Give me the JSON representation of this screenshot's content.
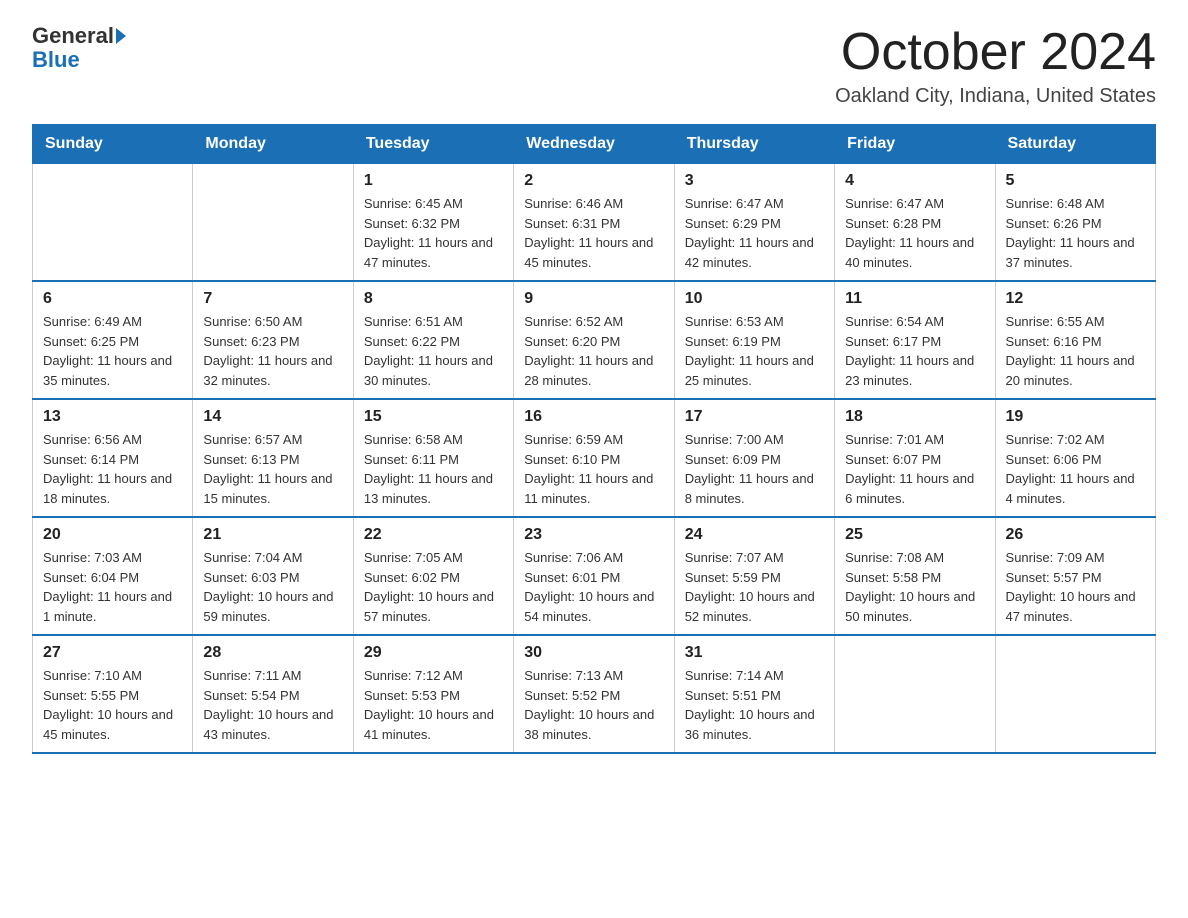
{
  "header": {
    "logo_general": "General",
    "logo_blue": "Blue",
    "month_title": "October 2024",
    "location": "Oakland City, Indiana, United States"
  },
  "days_of_week": [
    "Sunday",
    "Monday",
    "Tuesday",
    "Wednesday",
    "Thursday",
    "Friday",
    "Saturday"
  ],
  "weeks": [
    [
      {
        "day": "",
        "info": ""
      },
      {
        "day": "",
        "info": ""
      },
      {
        "day": "1",
        "info": "Sunrise: 6:45 AM\nSunset: 6:32 PM\nDaylight: 11 hours and 47 minutes."
      },
      {
        "day": "2",
        "info": "Sunrise: 6:46 AM\nSunset: 6:31 PM\nDaylight: 11 hours and 45 minutes."
      },
      {
        "day": "3",
        "info": "Sunrise: 6:47 AM\nSunset: 6:29 PM\nDaylight: 11 hours and 42 minutes."
      },
      {
        "day": "4",
        "info": "Sunrise: 6:47 AM\nSunset: 6:28 PM\nDaylight: 11 hours and 40 minutes."
      },
      {
        "day": "5",
        "info": "Sunrise: 6:48 AM\nSunset: 6:26 PM\nDaylight: 11 hours and 37 minutes."
      }
    ],
    [
      {
        "day": "6",
        "info": "Sunrise: 6:49 AM\nSunset: 6:25 PM\nDaylight: 11 hours and 35 minutes."
      },
      {
        "day": "7",
        "info": "Sunrise: 6:50 AM\nSunset: 6:23 PM\nDaylight: 11 hours and 32 minutes."
      },
      {
        "day": "8",
        "info": "Sunrise: 6:51 AM\nSunset: 6:22 PM\nDaylight: 11 hours and 30 minutes."
      },
      {
        "day": "9",
        "info": "Sunrise: 6:52 AM\nSunset: 6:20 PM\nDaylight: 11 hours and 28 minutes."
      },
      {
        "day": "10",
        "info": "Sunrise: 6:53 AM\nSunset: 6:19 PM\nDaylight: 11 hours and 25 minutes."
      },
      {
        "day": "11",
        "info": "Sunrise: 6:54 AM\nSunset: 6:17 PM\nDaylight: 11 hours and 23 minutes."
      },
      {
        "day": "12",
        "info": "Sunrise: 6:55 AM\nSunset: 6:16 PM\nDaylight: 11 hours and 20 minutes."
      }
    ],
    [
      {
        "day": "13",
        "info": "Sunrise: 6:56 AM\nSunset: 6:14 PM\nDaylight: 11 hours and 18 minutes."
      },
      {
        "day": "14",
        "info": "Sunrise: 6:57 AM\nSunset: 6:13 PM\nDaylight: 11 hours and 15 minutes."
      },
      {
        "day": "15",
        "info": "Sunrise: 6:58 AM\nSunset: 6:11 PM\nDaylight: 11 hours and 13 minutes."
      },
      {
        "day": "16",
        "info": "Sunrise: 6:59 AM\nSunset: 6:10 PM\nDaylight: 11 hours and 11 minutes."
      },
      {
        "day": "17",
        "info": "Sunrise: 7:00 AM\nSunset: 6:09 PM\nDaylight: 11 hours and 8 minutes."
      },
      {
        "day": "18",
        "info": "Sunrise: 7:01 AM\nSunset: 6:07 PM\nDaylight: 11 hours and 6 minutes."
      },
      {
        "day": "19",
        "info": "Sunrise: 7:02 AM\nSunset: 6:06 PM\nDaylight: 11 hours and 4 minutes."
      }
    ],
    [
      {
        "day": "20",
        "info": "Sunrise: 7:03 AM\nSunset: 6:04 PM\nDaylight: 11 hours and 1 minute."
      },
      {
        "day": "21",
        "info": "Sunrise: 7:04 AM\nSunset: 6:03 PM\nDaylight: 10 hours and 59 minutes."
      },
      {
        "day": "22",
        "info": "Sunrise: 7:05 AM\nSunset: 6:02 PM\nDaylight: 10 hours and 57 minutes."
      },
      {
        "day": "23",
        "info": "Sunrise: 7:06 AM\nSunset: 6:01 PM\nDaylight: 10 hours and 54 minutes."
      },
      {
        "day": "24",
        "info": "Sunrise: 7:07 AM\nSunset: 5:59 PM\nDaylight: 10 hours and 52 minutes."
      },
      {
        "day": "25",
        "info": "Sunrise: 7:08 AM\nSunset: 5:58 PM\nDaylight: 10 hours and 50 minutes."
      },
      {
        "day": "26",
        "info": "Sunrise: 7:09 AM\nSunset: 5:57 PM\nDaylight: 10 hours and 47 minutes."
      }
    ],
    [
      {
        "day": "27",
        "info": "Sunrise: 7:10 AM\nSunset: 5:55 PM\nDaylight: 10 hours and 45 minutes."
      },
      {
        "day": "28",
        "info": "Sunrise: 7:11 AM\nSunset: 5:54 PM\nDaylight: 10 hours and 43 minutes."
      },
      {
        "day": "29",
        "info": "Sunrise: 7:12 AM\nSunset: 5:53 PM\nDaylight: 10 hours and 41 minutes."
      },
      {
        "day": "30",
        "info": "Sunrise: 7:13 AM\nSunset: 5:52 PM\nDaylight: 10 hours and 38 minutes."
      },
      {
        "day": "31",
        "info": "Sunrise: 7:14 AM\nSunset: 5:51 PM\nDaylight: 10 hours and 36 minutes."
      },
      {
        "day": "",
        "info": ""
      },
      {
        "day": "",
        "info": ""
      }
    ]
  ]
}
